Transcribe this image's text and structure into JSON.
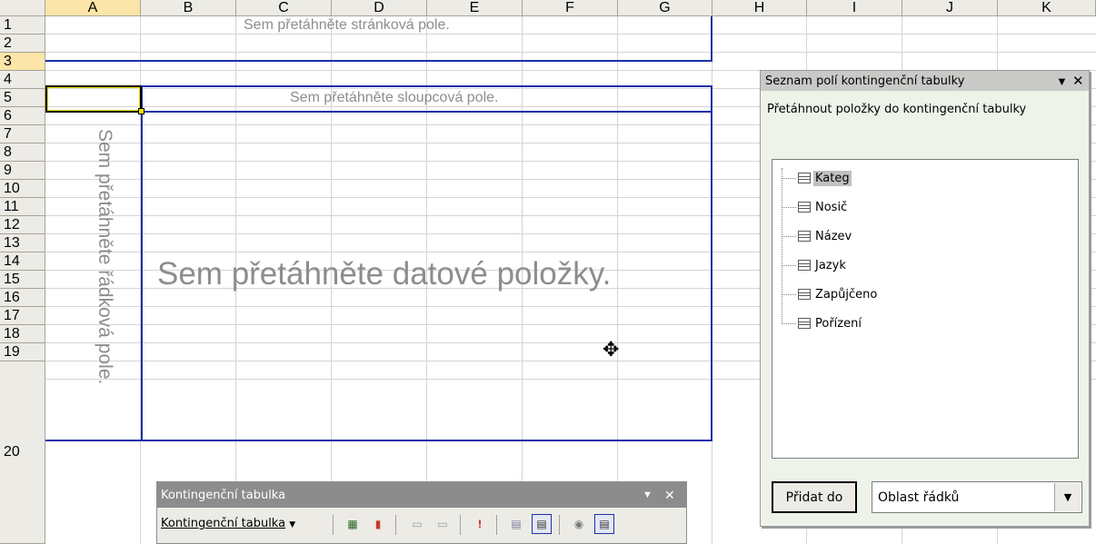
{
  "columns": [
    "A",
    "B",
    "C",
    "D",
    "E",
    "F",
    "G",
    "H",
    "I",
    "J",
    "K"
  ],
  "rows": [
    "1",
    "2",
    "3",
    "4",
    "5",
    "6",
    "7",
    "8",
    "9",
    "10",
    "11",
    "12",
    "13",
    "14",
    "15",
    "16",
    "17",
    "18",
    "19",
    "20"
  ],
  "pivot": {
    "page_fields_hint": "Sem přetáhněte stránková pole.",
    "column_fields_hint": "Sem přetáhněte sloupcová pole.",
    "row_fields_hint": "Sem přetáhněte řádková pole.",
    "data_items_hint": "Sem přetáhněte datové položky."
  },
  "field_list": {
    "title": "Seznam polí kontingenční tabulky",
    "hint": "Přetáhnout položky do kontingenční tabulky",
    "fields": [
      "Kateg",
      "Nosič",
      "Název",
      "Jazyk",
      "Zapůjčeno",
      "Pořízení"
    ],
    "add_button": "Přidat do",
    "area_value": "Oblast řádků"
  },
  "toolbar": {
    "title": "Kontingenční tabulka",
    "menu_label": "Kontingenční tabulka"
  },
  "icons": {
    "dropdown": "chevron-down-icon",
    "close": "close-icon",
    "cursor": "cross-cursor-icon"
  }
}
